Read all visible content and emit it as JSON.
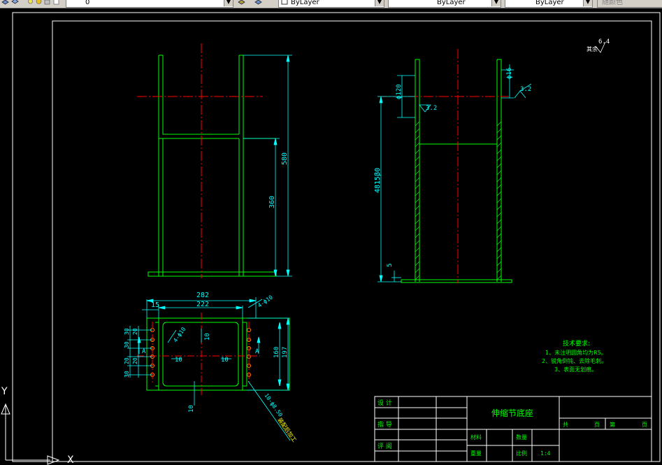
{
  "toolbar": {
    "layer_value": "0",
    "color_value": "ByLayer",
    "linetype_value": "ByLayer",
    "lineweight_value": "ByLayer",
    "plotstyle_value": "随颜色"
  },
  "drawing": {
    "surface_roughness_main": "6.4",
    "surface_roughness_main_prefix": "其余",
    "roughness_values": [
      "3.2",
      "3.2"
    ],
    "dims_front": [
      "580",
      "360"
    ],
    "dims_side": [
      "ϕ120",
      "ϕ16",
      "4815β0",
      "5"
    ],
    "dims_bottom": [
      "282",
      "222",
      "15",
      "4-ϕ10",
      "4-ϕ10",
      "10",
      "10",
      "10",
      "160",
      "197",
      "10",
      "30",
      "20",
      "20",
      "30",
      "20",
      "30",
      "A",
      "A"
    ],
    "weld_note": "10-ϕ8.50",
    "weld_note2": "装配后加工",
    "tech_req_title": "技术要求:",
    "tech_req_items": [
      "1、未注明圆角均为R5。",
      "2、锐角倒钝、去除毛刺。",
      "3、表面无划痕。"
    ]
  },
  "title_block": {
    "design_label": "设 计",
    "guide_label": "指 导",
    "review_label": "评 阅",
    "part_name": "伸缩节底座",
    "total_label": "共",
    "page_label": "页",
    "sheet_label": "第",
    "page_label2": "页",
    "material_label": "材料",
    "quantity_label": "数量",
    "weight_label": "重量",
    "scale_label": "比例",
    "scale_value": "1:4"
  },
  "ucs": {
    "y_label": "Y",
    "x_label": "X"
  }
}
